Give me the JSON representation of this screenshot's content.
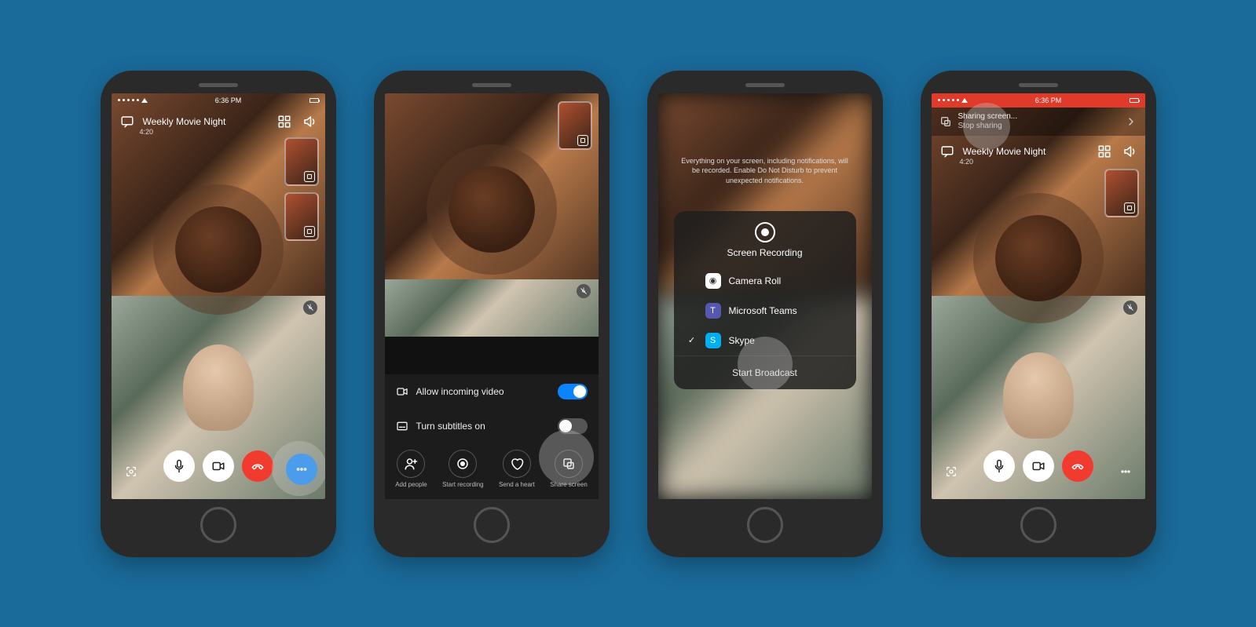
{
  "phone1": {
    "status_time": "6:36 PM",
    "call_title": "Weekly Movie Night",
    "call_duration": "4:20"
  },
  "phone2": {
    "thumb_visible": true,
    "toggles": [
      {
        "label": "Allow incoming video",
        "on": true
      },
      {
        "label": "Turn subtitles on",
        "on": false
      }
    ],
    "actions": [
      {
        "label": "Add people"
      },
      {
        "label": "Start recording"
      },
      {
        "label": "Send a heart"
      },
      {
        "label": "Share screen"
      }
    ]
  },
  "phone3": {
    "notice": "Everything on your screen, including notifications, will be recorded. Enable Do Not Disturb to prevent unexpected notifications.",
    "sheet_title": "Screen Recording",
    "apps": [
      {
        "name": "Camera Roll",
        "selected": false,
        "icon": "roll"
      },
      {
        "name": "Microsoft Teams",
        "selected": false,
        "icon": "teams"
      },
      {
        "name": "Skype",
        "selected": true,
        "icon": "skype"
      }
    ],
    "start_label": "Start Broadcast"
  },
  "phone4": {
    "status_time": "6:36 PM",
    "share_title": "Sharing screen...",
    "share_sub": "Stop sharing",
    "call_title": "Weekly Movie Night",
    "call_duration": "4:20"
  }
}
